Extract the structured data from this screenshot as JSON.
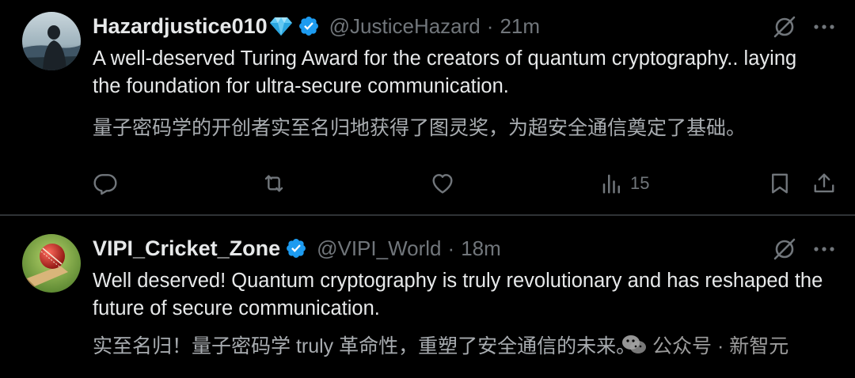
{
  "tweets": [
    {
      "display_name": "Hazardjustice010",
      "handle": "@JusticeHazard",
      "separator": "·",
      "time": "21m",
      "text": "A well-deserved Turing Award for the creators of quantum cryptography.. laying the foundation for ultra-secure communication.",
      "translation": "量子密码学的开创者实至名归地获得了图灵奖，为超安全通信奠定了基础。",
      "views": "15"
    },
    {
      "display_name": "VIPI_Cricket_Zone",
      "handle": "@VIPI_World",
      "separator": "·",
      "time": "18m",
      "text": "Well deserved! Quantum cryptography is truly revolutionary and has reshaped the future of secure communication.",
      "translation": "实至名归！量子密码学 truly 革命性，重塑了安全通信的未来。"
    }
  ],
  "watermark": "公众号 · 新智元",
  "colors": {
    "background": "#000000",
    "text": "#e7e9ea",
    "muted": "#71767b",
    "verified": "#1d9bf0",
    "divider": "#2f3336"
  }
}
